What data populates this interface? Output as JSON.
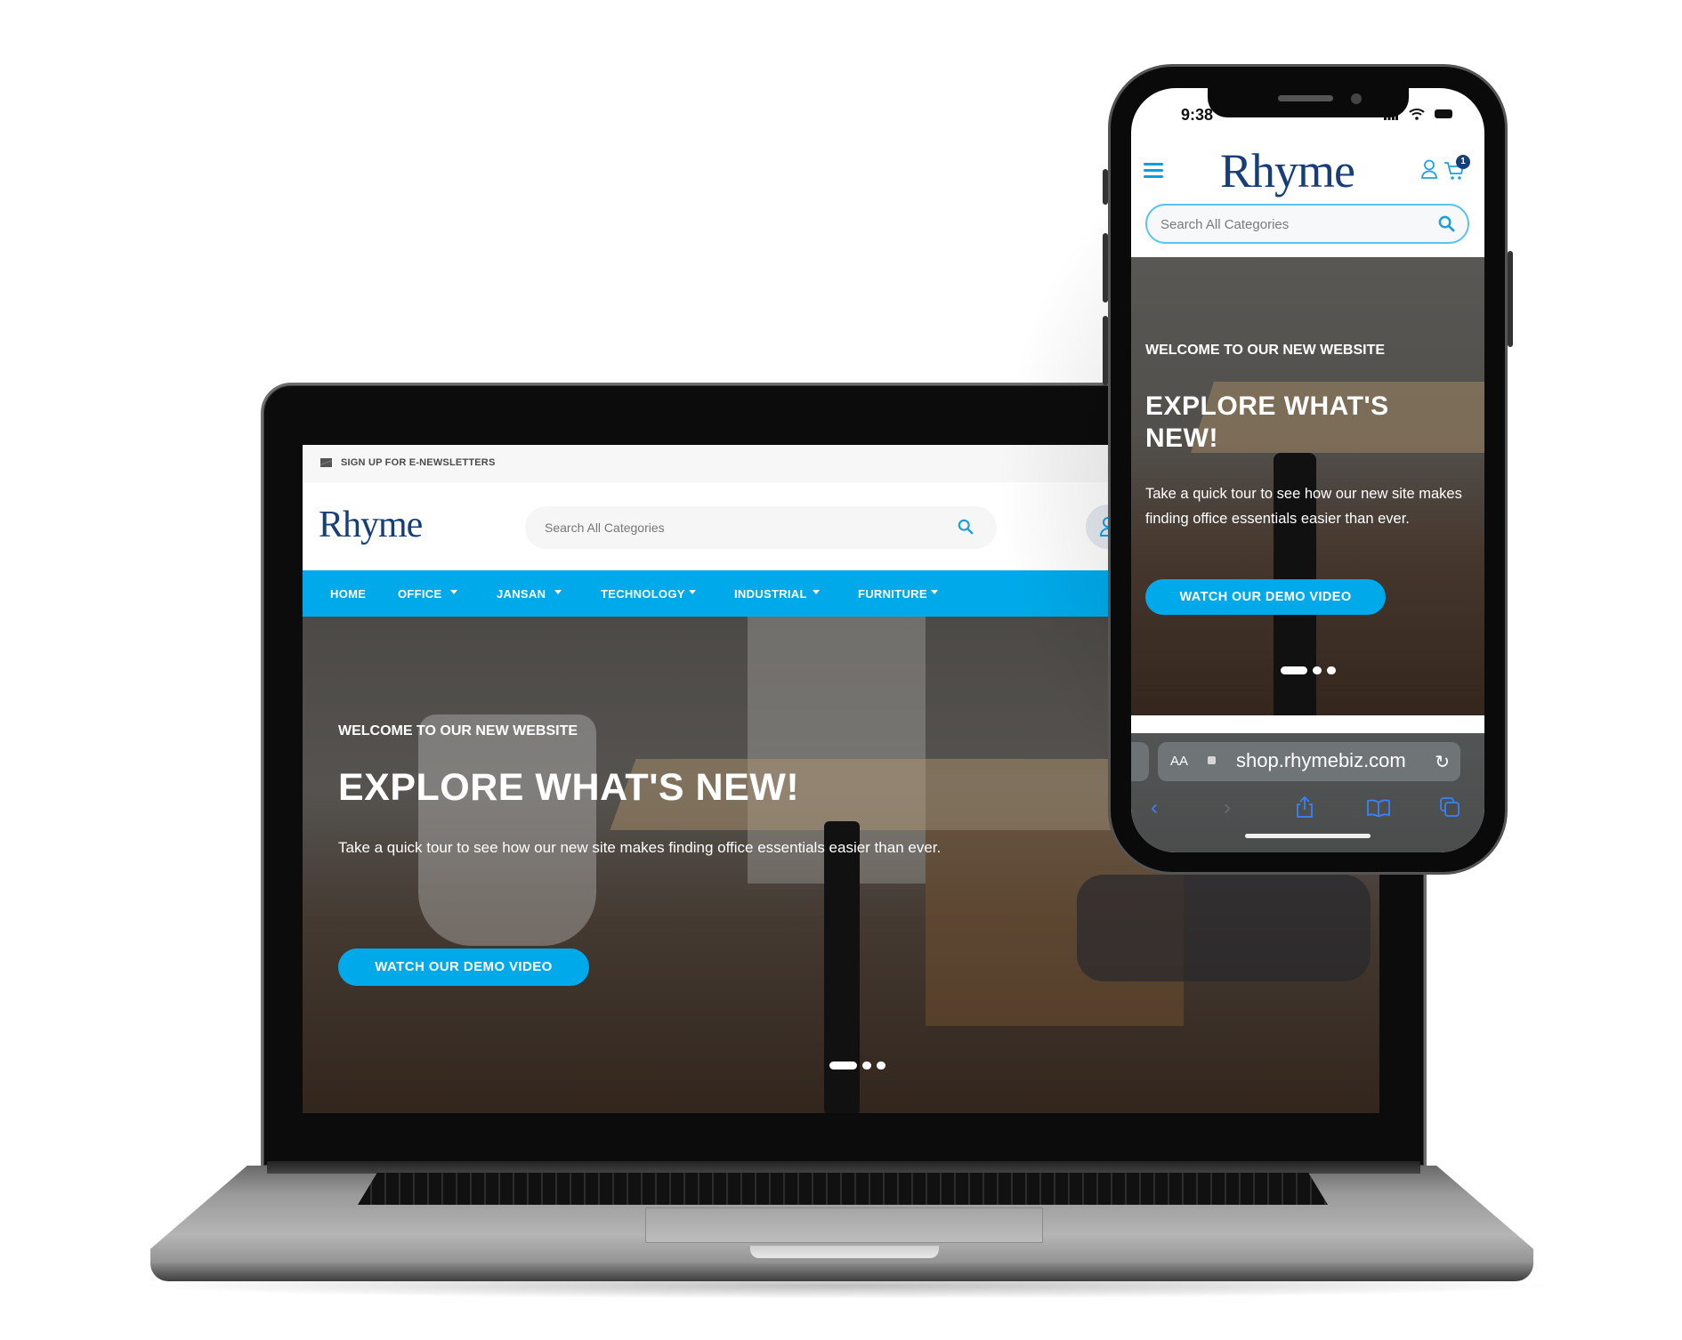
{
  "desktop": {
    "topbar": {
      "newsletter_label": "SIGN UP FOR E-NEWSLETTERS",
      "icon": "mail-icon"
    },
    "header": {
      "logo": "Rhyme",
      "search": {
        "placeholder": "Search All Categories",
        "value": "",
        "icon": "search-icon"
      },
      "account_icon": "user-icon"
    },
    "nav": {
      "items": [
        {
          "label": "HOME",
          "has_dropdown": false
        },
        {
          "label": "OFFICE",
          "has_dropdown": true
        },
        {
          "label": "JANSAN",
          "has_dropdown": true
        },
        {
          "label": "TECHNOLOGY",
          "has_dropdown": true
        },
        {
          "label": "INDUSTRIAL",
          "has_dropdown": true
        },
        {
          "label": "FURNITURE",
          "has_dropdown": true
        }
      ]
    },
    "hero": {
      "kicker": "WELCOME TO OUR NEW WEBSITE",
      "title": "EXPLORE WHAT'S NEW!",
      "body": "Take a quick tour to see how our new site makes finding office essentials easier than ever.",
      "cta_label": "WATCH OUR DEMO VIDEO",
      "slides_total": 3,
      "slide_active": 1
    }
  },
  "mobile": {
    "status_bar": {
      "time": "9:38",
      "icons": [
        "signal-icon",
        "wifi-icon",
        "battery-icon"
      ]
    },
    "header": {
      "logo": "Rhyme",
      "menu_icon": "hamburger-menu-icon",
      "account_icon": "user-icon",
      "cart_icon": "cart-icon",
      "cart_count": "1"
    },
    "search": {
      "placeholder": "Search All Categories",
      "value": "",
      "icon": "search-icon"
    },
    "hero": {
      "kicker": "WELCOME TO OUR NEW WEBSITE",
      "title": "EXPLORE WHAT'S NEW!",
      "body": "Take a quick tour to see how our new site makes finding office essentials easier than ever.",
      "cta_label": "WATCH OUR DEMO VIDEO",
      "slides_total": 3,
      "slide_active": 1
    },
    "browser": {
      "text_size_label": "AA",
      "url": "shop.rhymebiz.com",
      "toolbar": [
        "back-icon",
        "forward-icon",
        "share-icon",
        "bookmarks-icon",
        "tabs-icon"
      ]
    }
  },
  "colors": {
    "brand_blue": "#00aaea",
    "logo_navy": "#163f7a",
    "link_blue": "#3b82f6"
  }
}
